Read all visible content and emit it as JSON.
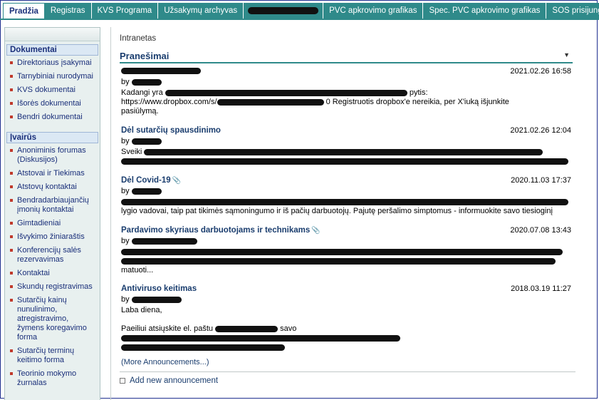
{
  "tabs": [
    {
      "label": "Pradžia",
      "active": true
    },
    {
      "label": "Registras"
    },
    {
      "label": "KVS Programa"
    },
    {
      "label": "Užsakymų archyvas"
    },
    {
      "label": ""
    },
    {
      "label": "PVC apkrovimo grafikas"
    },
    {
      "label": "Spec. PVC apkrovimo grafikas"
    },
    {
      "label": "SOS prisijungimas"
    }
  ],
  "sidebar": {
    "section1": "Dokumentai",
    "docs": [
      "Direktoriaus įsakymai",
      "Tarnybiniai nurodymai",
      "KVS dokumentai",
      "Išorės dokumentai",
      "Bendri dokumentai"
    ],
    "section2": "Įvairūs",
    "misc": [
      "Anoniminis forumas (Diskusijos)",
      "Atstovai ir Tiekimas",
      "Atstovų kontaktai",
      "Bendradarbiaujančių įmonių kontaktai",
      "Gimtadieniai",
      "Išvykimo žiniaraštis",
      "Konferencijų salės rezervavimas",
      "Kontaktai",
      "Skundų registravimas",
      "Sutarčių kainų nunulinimo, atregistravimo, žymens koregavimo forma",
      "Sutarčių terminų keitimo forma",
      "Teorinio mokymo žurnalas"
    ]
  },
  "main": {
    "breadcrumb": "Intranetas",
    "section_title": "Pranešimai",
    "more": "(More Announcements...)",
    "add": "Add new announcement"
  },
  "announcements": [
    {
      "title": "",
      "date": "2021.02.26 16:58",
      "by": "by",
      "body1": "Kadangi yra",
      "body1b": "pytis:",
      "body2": "https://www.dropbox.com/s/",
      "body2b": "0 Registruotis dropbox'e nereikia, per X'iuką išjunkite",
      "body3": "pasiūlymą."
    },
    {
      "title": "Dėl sutarčių spausdinimo",
      "date": "2021.02.26 12:04",
      "by": "by",
      "body1": "Sveiki"
    },
    {
      "title": "Dėl Covid-19",
      "date": "2020.11.03 17:37",
      "by": "by",
      "body2": "lygio vadovai, taip pat tikimės sąmoningumo ir iš pačių darbuotojų. Pajutę peršalimo simptomus - informuokite savo tiesioginį"
    },
    {
      "title": "Pardavimo skyriaus darbuotojams ir technikams",
      "date": "2020.07.08 13:43",
      "by": "by",
      "body3": "matuoti..."
    },
    {
      "title": "Antiviruso keitimas",
      "date": "2018.03.19 11:27",
      "by": "by",
      "body1": "Laba diena,",
      "body2": "Paeiliui atsiųskite el. paštu",
      "body2b": "savo"
    }
  ]
}
